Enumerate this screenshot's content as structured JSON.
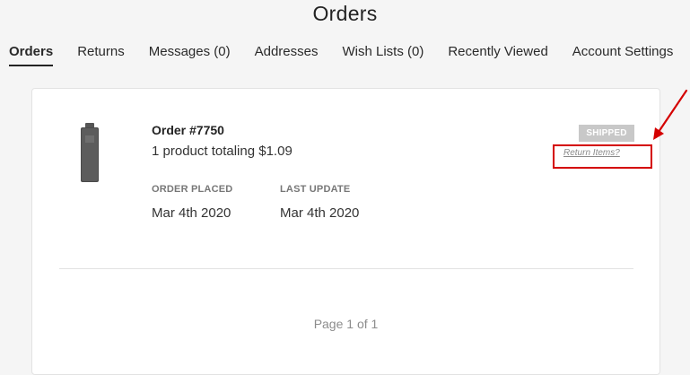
{
  "page": {
    "title": "Orders"
  },
  "tabs": [
    {
      "label": "Orders",
      "active": true
    },
    {
      "label": "Returns",
      "active": false
    },
    {
      "label": "Messages (0)",
      "active": false
    },
    {
      "label": "Addresses",
      "active": false
    },
    {
      "label": "Wish Lists (0)",
      "active": false
    },
    {
      "label": "Recently Viewed",
      "active": false
    },
    {
      "label": "Account Settings",
      "active": false
    }
  ],
  "order": {
    "number": "Order #7750",
    "summary": "1 product totaling $1.09",
    "placed_label": "ORDER PLACED",
    "placed_value": "Mar 4th 2020",
    "update_label": "LAST UPDATE",
    "update_value": "Mar 4th 2020",
    "status": "SHIPPED",
    "return_link": "Return Items?",
    "thumbnail_icon": "usb-drive-icon"
  },
  "pagination": {
    "text": "Page 1 of 1"
  },
  "colors": {
    "annotation": "#d40000",
    "badge_bg": "#c8c8c8",
    "active_tab_underline": "#232323"
  }
}
